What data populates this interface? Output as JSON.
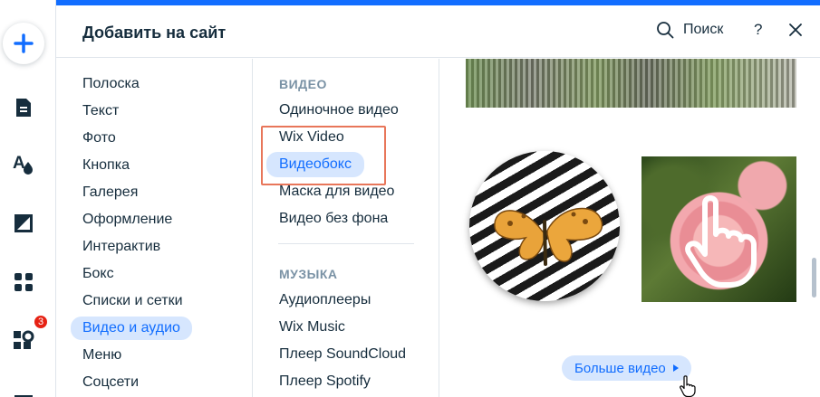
{
  "header": {
    "title": "Добавить на сайт",
    "search_label": "Поиск",
    "help_label": "?"
  },
  "rail": {
    "notification_count": "3"
  },
  "categories": [
    "Полоска",
    "Текст",
    "Фото",
    "Кнопка",
    "Галерея",
    "Оформление",
    "Интерактив",
    "Бокс",
    "Списки и сетки",
    "Видео и аудио",
    "Меню",
    "Соцсети"
  ],
  "active_category": "Видео и аудио",
  "video_section": {
    "title": "ВИДЕО",
    "items": [
      "Одиночное видео",
      "Wix Video",
      "Видеобокс",
      "Маска для видео",
      "Видео без фона"
    ]
  },
  "music_section": {
    "title": "МУЗЫКА",
    "items": [
      "Аудиоплееры",
      "Wix Music",
      "Плеер SoundCloud",
      "Плеер Spotify"
    ]
  },
  "active_item": "Видеобокс",
  "more_button": "Больше видео",
  "colors": {
    "accent": "#116dff",
    "active_bg": "#d6e6fe",
    "highlight_border": "#e8765a",
    "badge": "#e62214"
  }
}
